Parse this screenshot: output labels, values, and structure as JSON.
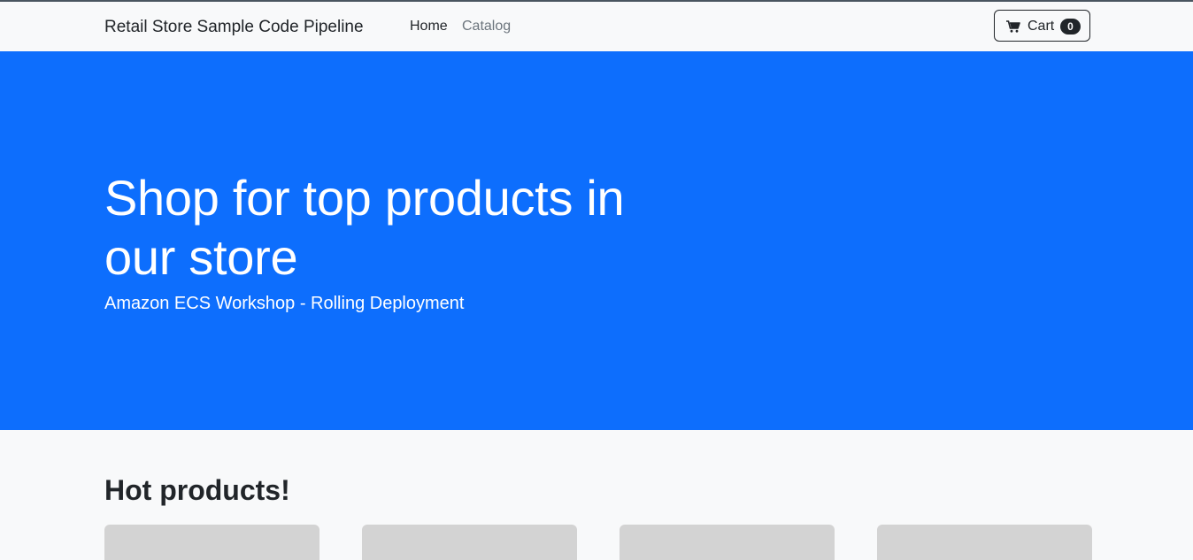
{
  "navbar": {
    "brand": "Retail Store Sample Code Pipeline",
    "links": [
      {
        "label": "Home"
      },
      {
        "label": "Catalog"
      }
    ],
    "cart": {
      "label": "Cart",
      "count": "0",
      "icon": "cart-icon"
    }
  },
  "hero": {
    "title": "Shop for top products in our store",
    "subtitle": "Amazon ECS Workshop - Rolling Deployment",
    "background_color": "#0d6efd"
  },
  "products": {
    "heading": "Hot products!",
    "placeholder_color": "#d3d3d3"
  }
}
